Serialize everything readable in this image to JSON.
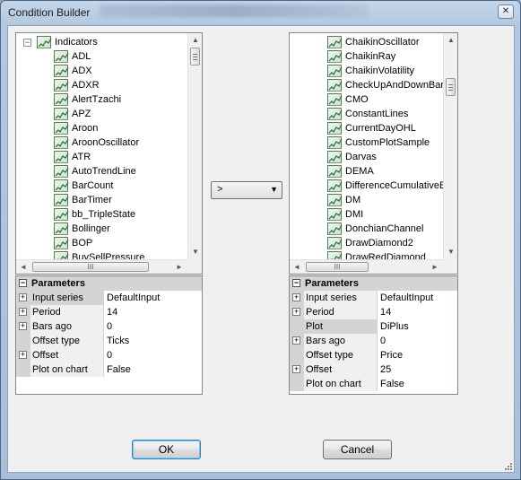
{
  "window": {
    "title": "Condition Builder",
    "close_glyph": "✕"
  },
  "left": {
    "root_label": "Indicators",
    "root_expander": "−",
    "items": [
      "ADL",
      "ADX",
      "ADXR",
      "AlertTzachi",
      "APZ",
      "Aroon",
      "AroonOscillator",
      "ATR",
      "AutoTrendLine",
      "BarCount",
      "BarTimer",
      "bb_TripleState",
      "Bollinger",
      "BOP",
      "BuySellPressure"
    ],
    "hscroll_thumb": "III",
    "params": {
      "header": "Parameters",
      "rows": [
        {
          "name": "Input series",
          "value": "DefaultInput",
          "expandable": true,
          "selected": true
        },
        {
          "name": "Period",
          "value": "14",
          "expandable": true,
          "selected": false
        },
        {
          "name": "Bars ago",
          "value": "0",
          "expandable": true,
          "selected": false
        },
        {
          "name": "Offset type",
          "value": "Ticks",
          "expandable": false,
          "selected": false
        },
        {
          "name": "Offset",
          "value": "0",
          "expandable": true,
          "selected": false
        },
        {
          "name": "Plot on chart",
          "value": "False",
          "expandable": false,
          "selected": false
        }
      ]
    }
  },
  "right": {
    "items": [
      "ChaikinOscillator",
      "ChaikinRay",
      "ChaikinVolatility",
      "CheckUpAndDownBars",
      "CMO",
      "ConstantLines",
      "CurrentDayOHL",
      "CustomPlotSample",
      "Darvas",
      "DEMA",
      "DifferenceCumulativeBars",
      "DM",
      "DMI",
      "DonchianChannel",
      "DrawDiamond2",
      "DrawRedDiamond"
    ],
    "hscroll_thumb": "III",
    "params": {
      "header": "Parameters",
      "rows": [
        {
          "name": "Input series",
          "value": "DefaultInput",
          "expandable": true,
          "selected": false
        },
        {
          "name": "Period",
          "value": "14",
          "expandable": true,
          "selected": false
        },
        {
          "name": "Plot",
          "value": "DiPlus",
          "expandable": false,
          "selected": true
        },
        {
          "name": "Bars ago",
          "value": "0",
          "expandable": true,
          "selected": false
        },
        {
          "name": "Offset type",
          "value": "Price",
          "expandable": false,
          "selected": false
        },
        {
          "name": "Offset",
          "value": "25",
          "expandable": true,
          "selected": false
        },
        {
          "name": "Plot on chart",
          "value": "False",
          "expandable": false,
          "selected": false
        }
      ]
    }
  },
  "operator": {
    "value": ">",
    "arrow": "▼"
  },
  "buttons": {
    "ok": "OK",
    "cancel": "Cancel"
  },
  "icons": {
    "indicator": "indicator-chart-icon",
    "expand": "⊞",
    "scroll_up": "▲",
    "scroll_down": "▼",
    "scroll_left": "◄",
    "scroll_right": "►"
  }
}
